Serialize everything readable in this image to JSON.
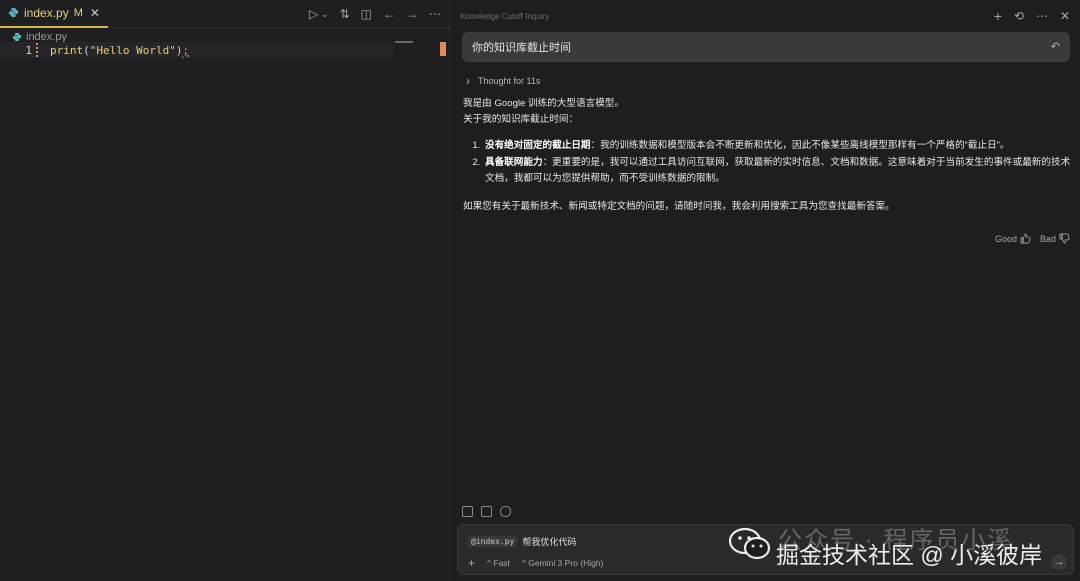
{
  "editor": {
    "tab": {
      "filename": "index.py",
      "status": "M",
      "close": "✕"
    },
    "breadcrumb": "index.py",
    "line_number": "1",
    "code": {
      "fn": "print",
      "open": "(",
      "str": "\"Hello World\"",
      "close": ")",
      "semi": ";"
    },
    "actions": {
      "run": "▷",
      "run_menu": "⌄",
      "diff": "⇅",
      "split": "◫",
      "back": "←",
      "forward": "→",
      "more": "⋯"
    }
  },
  "chat": {
    "title": "Knowledge Cutoff Inquiry",
    "header_actions": {
      "new": "+",
      "history": "⟲",
      "more": "⋯",
      "close": "✕"
    },
    "prompt": "你的知识库截止时间",
    "undo": "↶",
    "thought": {
      "chevron": "›",
      "label": "Thought for 11s"
    },
    "answer": {
      "intro1": "我是由 Google 训练的大型语言模型。",
      "intro2": "关于我的知识库截止时间：",
      "items": [
        {
          "bold": "没有绝对固定的截止日期",
          "text": "：我的训练数据和模型版本会不断更新和优化，因此不像某些离线模型那样有一个严格的“截止日”。"
        },
        {
          "bold": "具备联网能力",
          "text": "：更重要的是，我可以通过工具访问互联网，获取最新的实时信息、文档和数据。这意味着对于当前发生的事件或最新的技术文档，我都可以为您提供帮助，而不受训练数据的限制。"
        }
      ],
      "closing": "如果您有关于最新技术、新闻或特定文档的问题，请随时问我，我会利用搜索工具为您查找最新答案。"
    },
    "feedback": {
      "good": "Good",
      "bad": "Bad",
      "good_icon": "👍",
      "bad_icon": "👎"
    },
    "composer": {
      "mention": "@index.py",
      "text": "帮我优化代码",
      "add": "+",
      "mode": "Fast",
      "model": "Gemini 3 Pro (High)",
      "caret": "^",
      "send": "→"
    }
  },
  "watermark": {
    "line1": "公众号 · 程序员小溪",
    "line2": "掘金技术社区 @ 小溪彼岸"
  },
  "colors": {
    "accent_yellow": "#e6d27a",
    "gutter_orange": "#e58a5c",
    "background": "#1e1e20"
  }
}
